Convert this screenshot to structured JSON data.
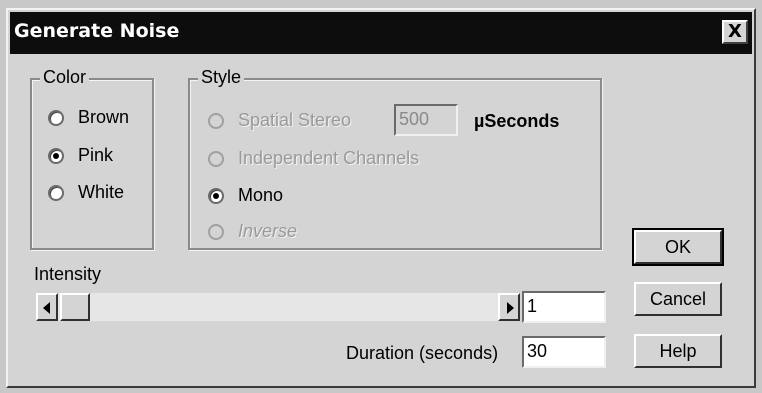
{
  "dialog": {
    "title": "Generate Noise",
    "close_label": "X"
  },
  "color_group": {
    "legend": "Color",
    "options": [
      {
        "label": "Brown",
        "selected": false
      },
      {
        "label": "Pink",
        "selected": true
      },
      {
        "label": "White",
        "selected": false
      }
    ]
  },
  "style_group": {
    "legend": "Style",
    "spatial_label": "Spatial Stereo",
    "spatial_value": "500",
    "spatial_unit": "µSeconds",
    "independent_label": "Independent Channels",
    "mono_label": "Mono",
    "inverse_label": "Inverse",
    "selected": "Mono"
  },
  "intensity": {
    "label": "Intensity",
    "value": "1"
  },
  "duration": {
    "label": "Duration (seconds)",
    "value": "30"
  },
  "buttons": {
    "ok": "OK",
    "cancel": "Cancel",
    "help": "Help"
  }
}
